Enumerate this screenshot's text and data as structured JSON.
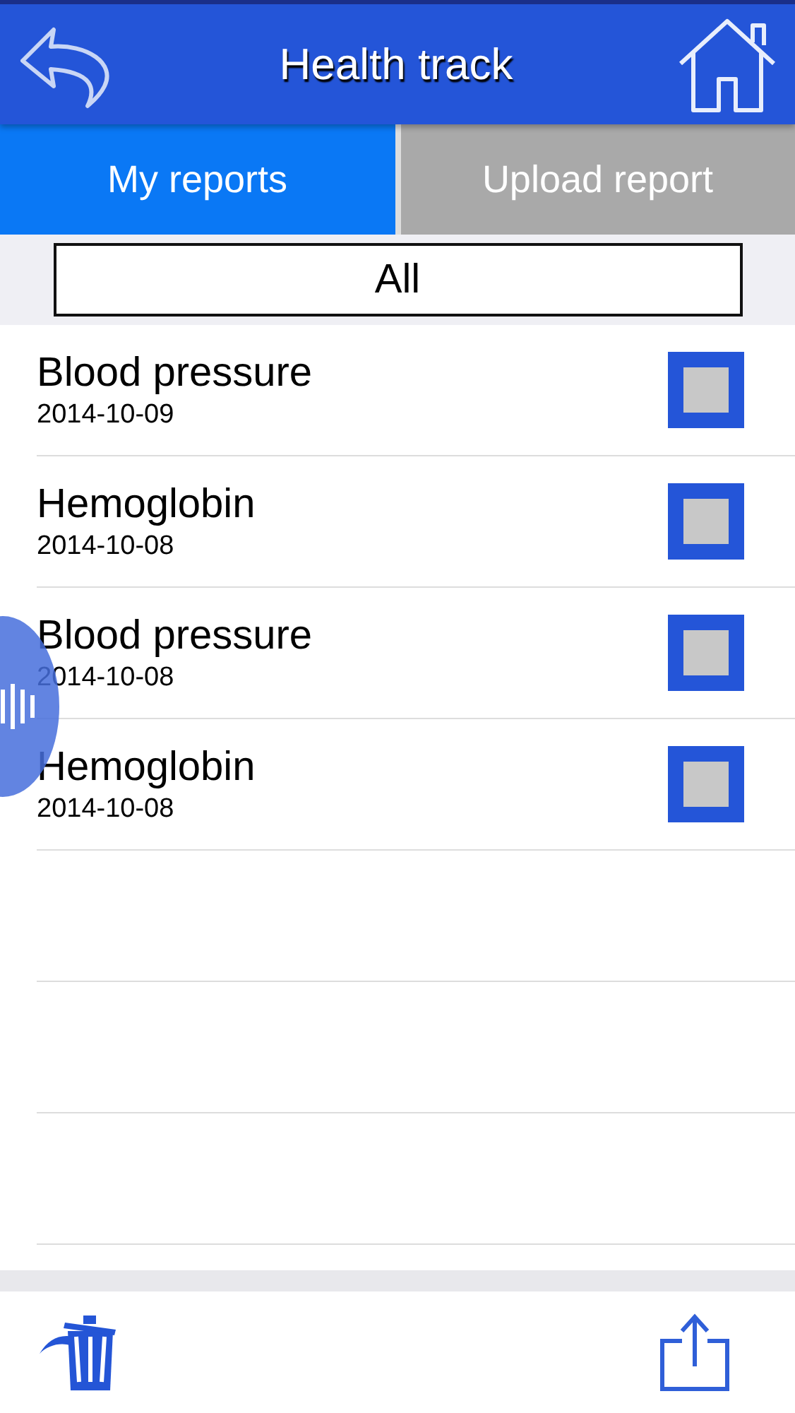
{
  "header": {
    "title": "Health track"
  },
  "tabs": [
    {
      "label": "My reports",
      "selected": true
    },
    {
      "label": "Upload report",
      "selected": false
    }
  ],
  "filter": {
    "value": "All"
  },
  "reports": [
    {
      "name": "Blood pressure",
      "date": "2014-10-09",
      "checked": false
    },
    {
      "name": "Hemoglobin",
      "date": "2014-10-08",
      "checked": false
    },
    {
      "name": "Blood pressure",
      "date": "2014-10-08",
      "checked": false
    },
    {
      "name": "Hemoglobin",
      "date": "2014-10-08",
      "checked": false
    }
  ]
}
